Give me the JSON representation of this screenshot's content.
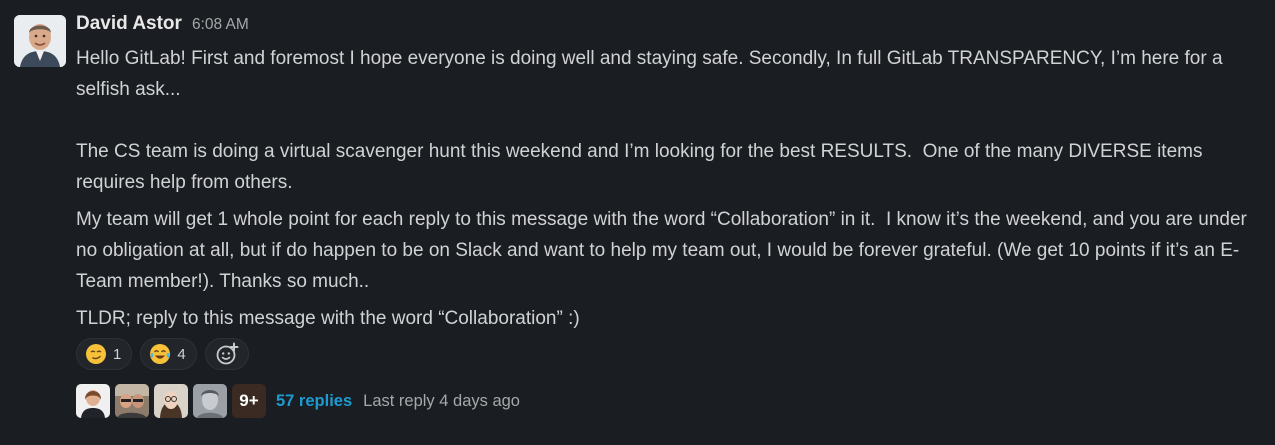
{
  "message": {
    "author": "David Astor",
    "timestamp": "6:08 AM",
    "paragraphs": [
      "Hello GitLab! First and foremost I hope everyone is doing well and staying safe. Secondly, In full GitLab TRANSPARENCY, I’m here for a selfish ask...",
      "The CS team is doing a virtual scavenger hunt this weekend and I’m looking for the best RESULTS.  One of the many DIVERSE items requires help from others.",
      "My team will get 1 whole point for each reply to this message with the word “Collaboration” in it.  I know it’s the weekend, and you are under no obligation at all, but if do happen to be on Slack and want to help my team out, I would be forever grateful. (We get 10 points if it’s an E-Team member!). Thanks so much..",
      "TLDR; reply to this message with the word “Collaboration” :)"
    ]
  },
  "reactions": [
    {
      "emoji": "smirk-emoji",
      "count": "1"
    },
    {
      "emoji": "joy-emoji",
      "count": "4"
    }
  ],
  "add_reaction_icon": "add-emoji-icon",
  "thread": {
    "more_count": "9+",
    "replies": "57 replies",
    "last_reply": "Last reply 4 days ago"
  },
  "colors": {
    "background": "#1a1d21",
    "link": "#1d9bd1",
    "text": "#d1d2d3"
  }
}
